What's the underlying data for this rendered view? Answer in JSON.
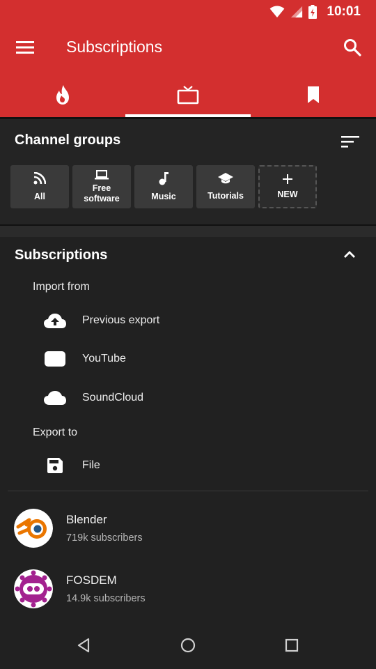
{
  "status_bar": {
    "time": "10:01",
    "icons": [
      "wifi-icon",
      "signal-icon",
      "battery-charging-icon"
    ]
  },
  "toolbar": {
    "title": "Subscriptions",
    "menu_icon": "hamburger-menu-icon",
    "search_icon": "search-icon"
  },
  "tabs": [
    {
      "icon": "trending-fire-icon",
      "selected": false
    },
    {
      "icon": "tv-subscriptions-icon",
      "selected": true
    },
    {
      "icon": "bookmark-icon",
      "selected": false
    }
  ],
  "channel_groups": {
    "header": "Channel groups",
    "sort_icon": "sort-icon",
    "groups": [
      {
        "label": "All",
        "icon": "rss-icon"
      },
      {
        "label": "Free software",
        "icon": "laptop-icon"
      },
      {
        "label": "Music",
        "icon": "music-note-icon"
      },
      {
        "label": "Tutorials",
        "icon": "school-icon"
      }
    ],
    "new_label": "NEW",
    "new_icon": "plus-icon"
  },
  "subscriptions": {
    "header": "Subscriptions",
    "collapse_icon": "chevron-up-icon",
    "import_header": "Import from",
    "import_items": [
      {
        "label": "Previous export",
        "icon": "cloud-upload-icon"
      },
      {
        "label": "YouTube",
        "icon": "youtube-icon"
      },
      {
        "label": "SoundCloud",
        "icon": "cloud-icon"
      }
    ],
    "export_header": "Export to",
    "export_items": [
      {
        "label": "File",
        "icon": "save-icon"
      }
    ],
    "channels": [
      {
        "name": "Blender",
        "subscribers": "719k subscribers",
        "avatar": "blender-logo"
      },
      {
        "name": "FOSDEM",
        "subscribers": "14.9k subscribers",
        "avatar": "fosdem-logo"
      }
    ]
  },
  "nav_bar": {
    "icons": [
      "back-icon",
      "home-icon",
      "recents-icon"
    ]
  },
  "colors": {
    "accent": "#d32f2f",
    "background": "#212121",
    "chip": "#3a3a3a"
  }
}
